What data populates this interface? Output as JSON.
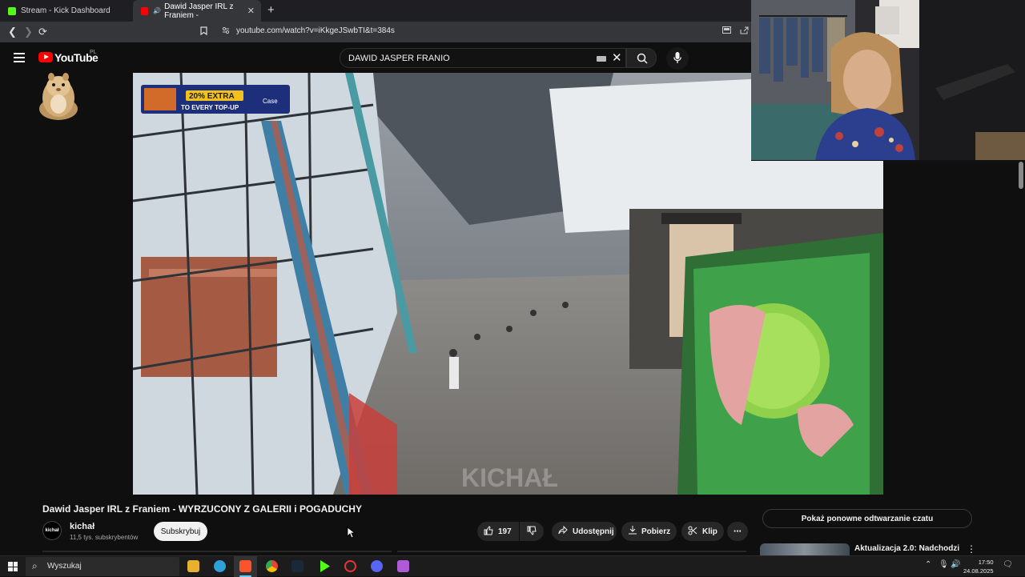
{
  "browser": {
    "tabs": [
      {
        "title": "Stream - Kick Dashboard",
        "favicon_color": "#53fc18",
        "active": false
      },
      {
        "title": "Dawid Jasper IRL z Franiem -",
        "favicon_color": "#ff0000",
        "active": true
      }
    ],
    "url": "youtube.com/watch?v=iKkgeJSwbTI&t=384s"
  },
  "youtube": {
    "logo_text": "YouTube",
    "country_code": "PL",
    "search_query": "DAWID JASPER FRANIO"
  },
  "video": {
    "overlay_banner": {
      "line1": "20% EXTRA",
      "line2": "TO EVERY TOP-UP",
      "brand": "Case"
    },
    "watermark": "KICHAŁ",
    "title": "Dawid Jasper IRL z Franiem - WYRZUCONY Z GALERII i POGADUCHY",
    "channel": {
      "name": "kichał",
      "avatar_text": "kichał",
      "subscribers": "11,5 tys. subskrybentów"
    },
    "subscribe_label": "Subskrybuj",
    "likes": "197",
    "share_label": "Udostępnij",
    "download_label": "Pobierz",
    "clip_label": "Klip",
    "more_label": "⋯"
  },
  "sidebar": {
    "chat_replay_label": "Pokaż ponowne odtwarzanie czatu",
    "recommended": [
      {
        "title": "Aktualizacja 2.0: Nadchodzi"
      }
    ]
  },
  "taskbar": {
    "search_placeholder": "Wyszukaj",
    "time": "17:50",
    "date": "24.08.2025"
  }
}
